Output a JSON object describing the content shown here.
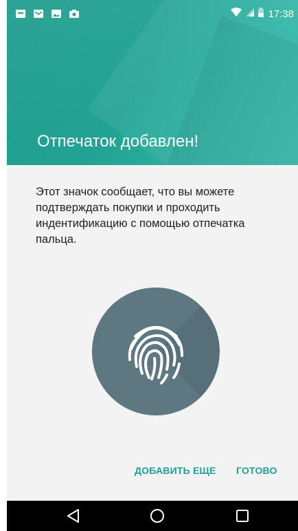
{
  "status_bar": {
    "time": "17:38",
    "notification_icons": [
      "app-notification-icon",
      "email-icon",
      "image-icon",
      "camera-icon"
    ],
    "system_icons": [
      "wifi-icon",
      "signal-icon",
      "battery-icon"
    ]
  },
  "header": {
    "title": "Отпечаток добавлен!",
    "color": "#23a394"
  },
  "body": {
    "description": "Этот значок сообщает, что вы можете подтверждать покупки и проходить индентификацию с помощью отпечатка пальца.",
    "icon": "fingerprint-icon"
  },
  "actions": {
    "add_more": "ДОБАВИТЬ ЕЩЕ",
    "done": "ГОТОВО",
    "accent_color": "#1fa191"
  },
  "nav_bar": {
    "buttons": [
      "back-icon",
      "home-icon",
      "recent-apps-icon"
    ]
  }
}
